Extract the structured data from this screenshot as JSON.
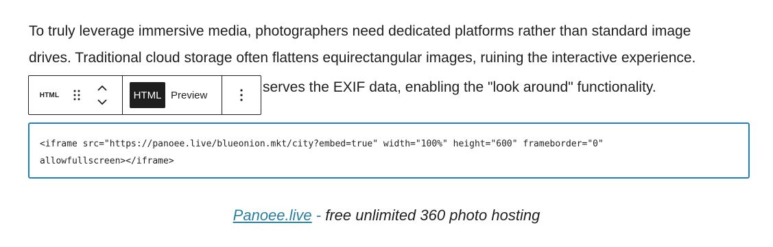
{
  "paragraph": {
    "line1": "To truly leverage immersive media, photographers need dedicated platforms rather than standard image",
    "line2": "drives. Traditional cloud storage often flattens equirectangular images, ruining the interactive experience.",
    "line3_visible": "serves the EXIF data, enabling the \"look around\" functionality."
  },
  "toolbar": {
    "block_type_label": "HTML",
    "drag_icon": "drag-handle-icon",
    "move_up_icon": "chevron-up-icon",
    "move_down_icon": "chevron-down-icon",
    "tab_html_label": "HTML",
    "tab_preview_label": "Preview",
    "options_icon": "more-vertical-icon"
  },
  "code_editor": {
    "line1": "<iframe src=\"https://panoee.live/blueonion.mkt/city?embed=true\" width=\"100%\" height=\"600\" frameborder=\"0\"",
    "line2": "allowfullscreen></iframe>",
    "focus_border_color": "#1e7fbd"
  },
  "caption": {
    "link_text": "Panoee.live",
    "separator": " - ",
    "text": "free unlimited 360 photo hosting",
    "link_color": "#2b7ea1"
  }
}
